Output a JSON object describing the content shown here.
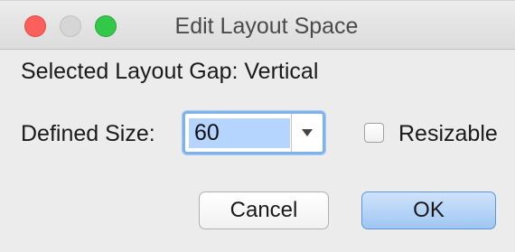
{
  "window": {
    "title": "Edit Layout Space"
  },
  "gap": {
    "label": "Selected Layout Gap: Vertical"
  },
  "size": {
    "label": "Defined Size:",
    "value": "60"
  },
  "resizable": {
    "label": "Resizable",
    "checked": false
  },
  "buttons": {
    "cancel": "Cancel",
    "ok": "OK"
  },
  "colors": {
    "close": "#fc605c",
    "minimize": "#d6d6d6",
    "maximize": "#34c84a",
    "focus_ring": "#7fb2ec",
    "selection": "#b5d5ff",
    "default_button": "#9fc6f3"
  },
  "icons": [
    "close-icon",
    "minimize-icon",
    "maximize-icon",
    "chevron-down-icon",
    "checkbox-icon"
  ]
}
